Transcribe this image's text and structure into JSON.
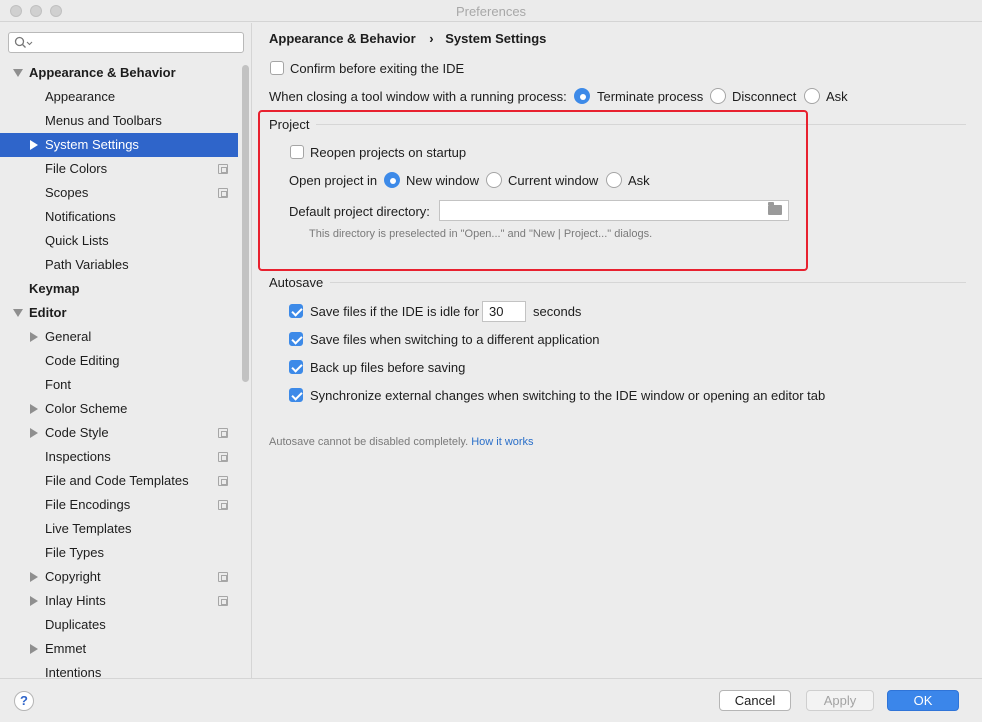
{
  "window": {
    "title": "Preferences"
  },
  "sidebar": {
    "search_placeholder": "",
    "items": [
      {
        "label": "Appearance & Behavior",
        "bold": true,
        "expanded": true
      },
      {
        "label": "Appearance"
      },
      {
        "label": "Menus and Toolbars"
      },
      {
        "label": "System Settings",
        "selected": true,
        "has_arrow": true
      },
      {
        "label": "File Colors",
        "project_icon": true
      },
      {
        "label": "Scopes",
        "project_icon": true
      },
      {
        "label": "Notifications"
      },
      {
        "label": "Quick Lists"
      },
      {
        "label": "Path Variables"
      },
      {
        "label": "Keymap",
        "bold": true
      },
      {
        "label": "Editor",
        "bold": true,
        "expanded": true
      },
      {
        "label": "General",
        "has_arrow": true
      },
      {
        "label": "Code Editing"
      },
      {
        "label": "Font"
      },
      {
        "label": "Color Scheme",
        "has_arrow": true
      },
      {
        "label": "Code Style",
        "has_arrow": true,
        "project_icon": true
      },
      {
        "label": "Inspections",
        "project_icon": true
      },
      {
        "label": "File and Code Templates",
        "project_icon": true
      },
      {
        "label": "File Encodings",
        "project_icon": true
      },
      {
        "label": "Live Templates"
      },
      {
        "label": "File Types"
      },
      {
        "label": "Copyright",
        "has_arrow": true,
        "project_icon": true
      },
      {
        "label": "Inlay Hints",
        "has_arrow": true,
        "project_icon": true
      },
      {
        "label": "Duplicates"
      },
      {
        "label": "Emmet",
        "has_arrow": true
      },
      {
        "label": "Intentions"
      }
    ]
  },
  "breadcrumb": {
    "parent": "Appearance & Behavior",
    "separator": "›",
    "current": "System Settings"
  },
  "general": {
    "confirm_exit": {
      "label": "Confirm before exiting the IDE",
      "checked": false
    },
    "closing_label": "When closing a tool window with a running process:",
    "closing_options": [
      {
        "label": "Terminate process",
        "selected": true
      },
      {
        "label": "Disconnect",
        "selected": false
      },
      {
        "label": "Ask",
        "selected": false
      }
    ]
  },
  "project": {
    "title": "Project",
    "reopen": {
      "label": "Reopen projects on startup",
      "checked": false
    },
    "open_in_label": "Open project in",
    "open_in_options": [
      {
        "label": "New window",
        "selected": true
      },
      {
        "label": "Current window",
        "selected": false
      },
      {
        "label": "Ask",
        "selected": false
      }
    ],
    "default_dir_label": "Default project directory:",
    "default_dir_value": "",
    "hint": "This directory is preselected in \"Open...\" and \"New | Project...\" dialogs."
  },
  "autosave": {
    "title": "Autosave",
    "idle": {
      "label_before": "Save files if the IDE is idle for",
      "value": "30",
      "label_after": "seconds",
      "checked": true
    },
    "switch_app": {
      "label": "Save files when switching to a different application",
      "checked": true
    },
    "backup": {
      "label": "Back up files before saving",
      "checked": true
    },
    "sync": {
      "label": "Synchronize external changes when switching to the IDE window or opening an editor tab",
      "checked": true
    },
    "note": "Autosave cannot be disabled completely.",
    "note_link": "How it works"
  },
  "footer": {
    "help": "?",
    "cancel": "Cancel",
    "apply": "Apply",
    "ok": "OK"
  },
  "colors": {
    "accent": "#3b86ea",
    "selection": "#2f65ca",
    "highlight_border": "#e8212f",
    "link": "#2a6fc9"
  }
}
